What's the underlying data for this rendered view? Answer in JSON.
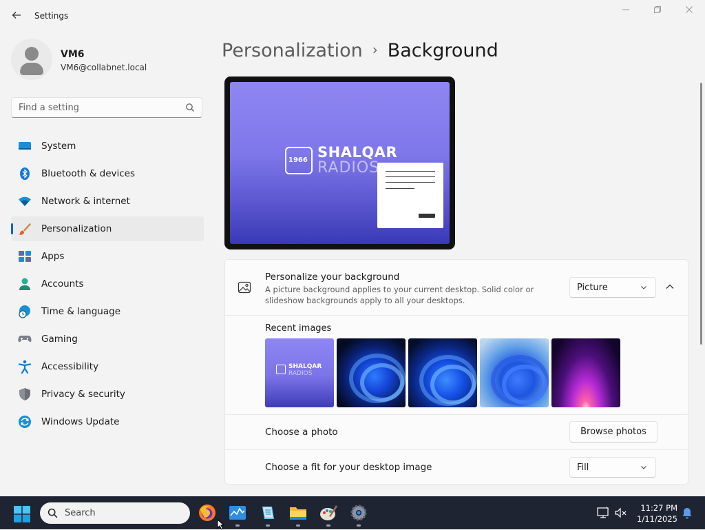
{
  "window": {
    "title": "Settings",
    "controls": {
      "minimize": "—",
      "maximize": "▢",
      "close": "✕"
    }
  },
  "user": {
    "name": "VM6",
    "email": "VM6@collabnet.local"
  },
  "search": {
    "placeholder": "Find a setting"
  },
  "sidebar": {
    "items": [
      {
        "label": "System",
        "icon": "monitor-icon"
      },
      {
        "label": "Bluetooth & devices",
        "icon": "bluetooth-icon"
      },
      {
        "label": "Network & internet",
        "icon": "wifi-icon"
      },
      {
        "label": "Personalization",
        "icon": "brush-icon",
        "active": true
      },
      {
        "label": "Apps",
        "icon": "apps-icon"
      },
      {
        "label": "Accounts",
        "icon": "person-icon"
      },
      {
        "label": "Time & language",
        "icon": "globe-clock-icon"
      },
      {
        "label": "Gaming",
        "icon": "gamepad-icon"
      },
      {
        "label": "Accessibility",
        "icon": "accessibility-icon"
      },
      {
        "label": "Privacy & security",
        "icon": "shield-icon"
      },
      {
        "label": "Windows Update",
        "icon": "update-icon"
      }
    ]
  },
  "breadcrumb": {
    "parent": "Personalization",
    "separator": "›",
    "current": "Background"
  },
  "preview": {
    "logo_year": "1966",
    "logo_name_top": "SHALQAR",
    "logo_name_bottom": "RADIOS"
  },
  "background": {
    "title": "Personalize your background",
    "description": "A picture background applies to your current desktop. Solid color or slideshow backgrounds apply to all your desktops.",
    "type_value": "Picture",
    "recent_label": "Recent images",
    "choose_photo_label": "Choose a photo",
    "browse_label": "Browse photos",
    "fit_label": "Choose a fit for your desktop image",
    "fit_value": "Fill"
  },
  "taskbar": {
    "search_placeholder": "Search",
    "apps": [
      "firefox-icon",
      "task-manager-icon",
      "notepad-icon",
      "file-explorer-icon",
      "paint-icon",
      "settings-icon"
    ],
    "time": "11:27 PM",
    "date": "1/11/2025"
  },
  "colors": {
    "accent": "#0067c0",
    "taskbar": "#1f2433",
    "preview_purple": "#8f86f3"
  }
}
